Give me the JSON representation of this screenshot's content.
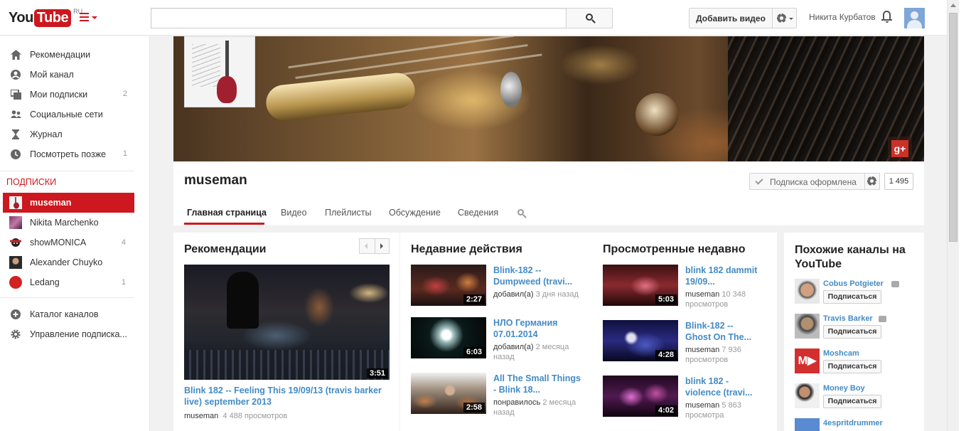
{
  "header": {
    "logo_you": "You",
    "logo_tube": "Tube",
    "logo_region": "RU",
    "search_placeholder": "",
    "upload_label": "Добавить видео",
    "user_name": "Никита Курбатов"
  },
  "sidebar": {
    "nav": [
      {
        "label": "Рекомендации",
        "icon": "home-icon",
        "count": ""
      },
      {
        "label": "Мой канал",
        "icon": "user-icon",
        "count": ""
      },
      {
        "label": "Мои подписки",
        "icon": "subscriptions-icon",
        "count": "2"
      },
      {
        "label": "Социальные сети",
        "icon": "social-icon",
        "count": ""
      },
      {
        "label": "Журнал",
        "icon": "history-icon",
        "count": ""
      },
      {
        "label": "Посмотреть позже",
        "icon": "clock-icon",
        "count": "1"
      }
    ],
    "subs_header": "ПОДПИСКИ",
    "subs": [
      {
        "label": "museman",
        "count": "",
        "active": true
      },
      {
        "label": "Nikita Marchenko",
        "count": ""
      },
      {
        "label": "showMONICA",
        "count": "4"
      },
      {
        "label": "Alexander Chuyko",
        "count": ""
      },
      {
        "label": "Ledang",
        "count": "1"
      }
    ],
    "footer": [
      {
        "label": "Каталог каналов",
        "icon": "plus-icon"
      },
      {
        "label": "Управление подписка...",
        "icon": "gear-icon"
      }
    ]
  },
  "channel": {
    "title": "museman",
    "subscribed_label": "Подписка оформлена",
    "subscriber_count": "1 495",
    "tabs": [
      "Главная страница",
      "Видео",
      "Плейлисты",
      "Обсуждение",
      "Сведения"
    ],
    "active_tab": 0
  },
  "recommended": {
    "title": "Рекомендации",
    "video": {
      "title": "Blink 182 -- Feeling This 19/09/13 (travis barker live) september 2013",
      "duration": "3:51",
      "owner": "museman",
      "views": "4 488 просмотров"
    }
  },
  "activity": {
    "title": "Недавние действия",
    "items": [
      {
        "title": "Blink-182 -- Dumpweed (travi...",
        "duration": "2:27",
        "meta": "добавил(а)",
        "when": "3 дня назад"
      },
      {
        "title": "НЛО Германия 07.01.2014",
        "duration": "6:03",
        "meta": "добавил(а)",
        "when": "2 месяца назад"
      },
      {
        "title": "All The Small Things - Blink 18...",
        "duration": "2:58",
        "meta": "понравилось",
        "when": "2 месяца назад"
      }
    ]
  },
  "watched": {
    "title": "Просмотренные недавно",
    "items": [
      {
        "title": "blink 182 dammit 19/09...",
        "duration": "5:03",
        "owner": "museman",
        "views": "10 348 просмотров"
      },
      {
        "title": "Blink-182 -- Ghost On The...",
        "duration": "4:28",
        "owner": "museman",
        "views": "7 936 просмотров"
      },
      {
        "title": "blink 182 - violence (travi...",
        "duration": "4:02",
        "owner": "museman",
        "views": "5 863 просмотра"
      }
    ]
  },
  "related": {
    "title": "Похожие каналы на YouTube",
    "subscribe_label": "Подписаться",
    "items": [
      {
        "name": "Cobus Potgieter",
        "verified": true
      },
      {
        "name": "Travis Barker",
        "verified": true
      },
      {
        "name": "Moshcam",
        "verified": false
      },
      {
        "name": "Money Boy",
        "verified": false
      },
      {
        "name": "4espritdrummer",
        "verified": false
      }
    ]
  },
  "colors": {
    "brand_red": "#cc181e",
    "link_blue": "#438bc5"
  }
}
